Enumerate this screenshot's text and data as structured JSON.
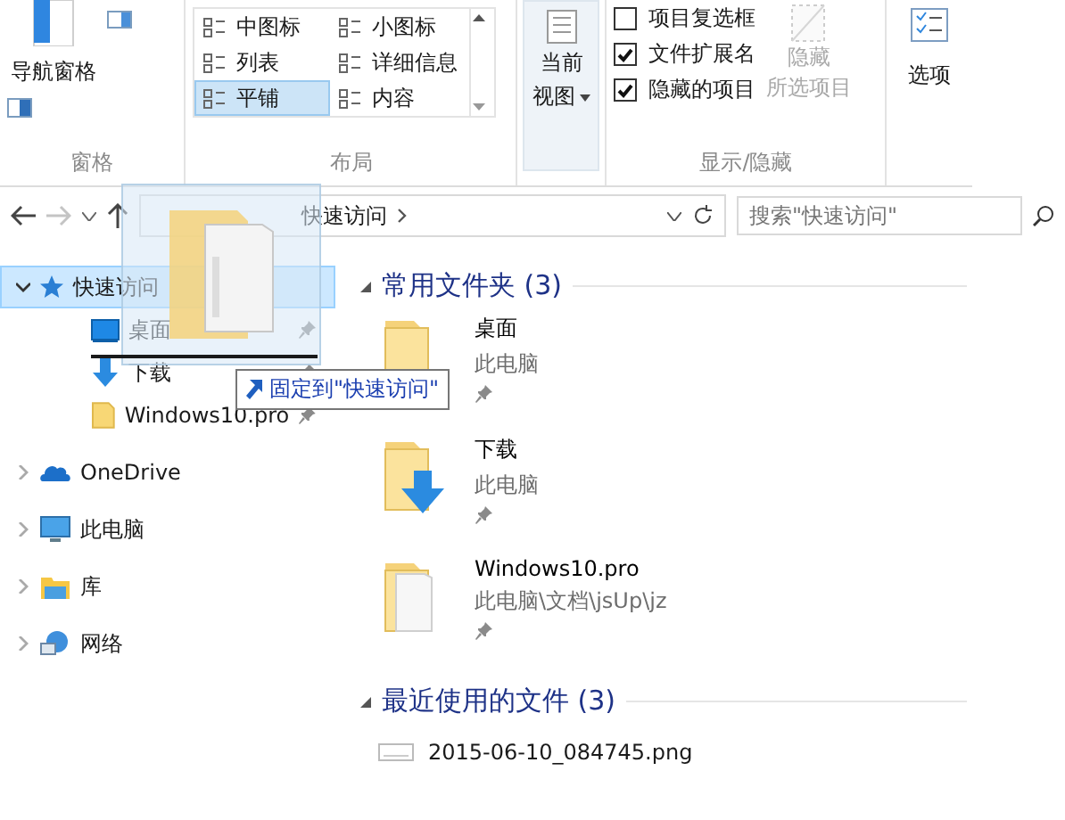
{
  "ribbon": {
    "pane": {
      "nav_button": "导航窗格",
      "group": "窗格"
    },
    "layout": {
      "group": "布局",
      "options": [
        {
          "label": "中图标",
          "selected": false
        },
        {
          "label": "小图标",
          "selected": false
        },
        {
          "label": "列表",
          "selected": false
        },
        {
          "label": "详细信息",
          "selected": false
        },
        {
          "label": "平铺",
          "selected": true
        },
        {
          "label": "内容",
          "selected": false
        }
      ]
    },
    "current_view": {
      "lines": [
        "当前",
        "视图"
      ]
    },
    "show_hide": {
      "group": "显示/隐藏",
      "checkboxes": [
        {
          "label": "项目复选框",
          "checked": false
        },
        {
          "label": "文件扩展名",
          "checked": true
        },
        {
          "label": "隐藏的项目",
          "checked": true
        }
      ],
      "hide_button": {
        "lines": [
          "隐藏",
          "所选项目"
        ],
        "disabled": true
      }
    },
    "options": {
      "label": "选项"
    }
  },
  "address_bar": {
    "path": "快速访问",
    "search_placeholder": "搜索\"快速访问\""
  },
  "nav": [
    {
      "label": "快速访问",
      "expanded": true,
      "selected": true,
      "children": [
        {
          "label": "桌面",
          "pinned": true
        },
        {
          "label": "下载",
          "pinned": true
        },
        {
          "label": "Windows10.pro",
          "pinned": true
        }
      ]
    },
    {
      "label": "OneDrive",
      "expanded": false,
      "selected": false
    },
    {
      "label": "此电脑",
      "expanded": false,
      "selected": false
    },
    {
      "label": "库",
      "expanded": false,
      "selected": false
    },
    {
      "label": "网络",
      "expanded": false,
      "selected": false
    }
  ],
  "content": {
    "sections": [
      {
        "title": "常用文件夹 (3)",
        "expanded": true,
        "items": [
          {
            "kind": "folder",
            "name": "桌面",
            "location": "此电脑",
            "pinned": true
          },
          {
            "kind": "folder",
            "name": "下载",
            "location": "此电脑",
            "pinned": true
          },
          {
            "kind": "folder",
            "name": "Windows10.pro",
            "location": "此电脑\\文档\\jsUp\\jz",
            "pinned": true
          }
        ]
      },
      {
        "title": "最近使用的文件 (3)",
        "expanded": true,
        "items": [
          {
            "kind": "file",
            "name": "2015-06-10_084745.png"
          }
        ]
      }
    ]
  },
  "drag": {
    "tooltip": "固定到\"快速访问\""
  }
}
